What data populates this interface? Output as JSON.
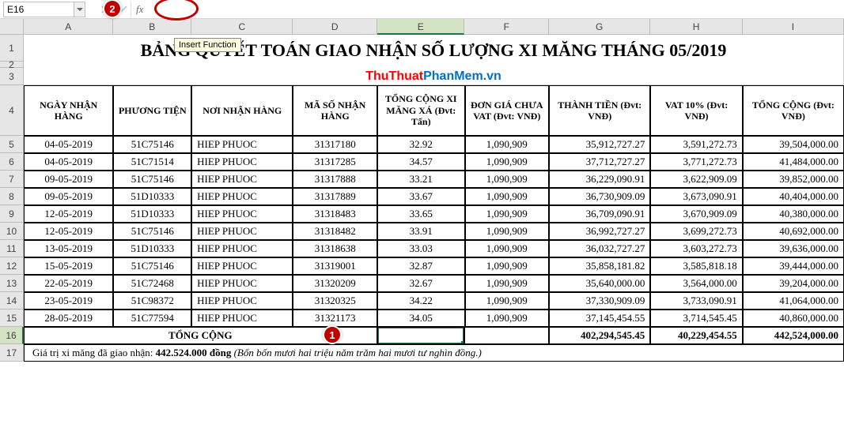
{
  "nameBox": "E16",
  "fxLabel": "fx",
  "tooltip": "Insert Function",
  "badge1": "1",
  "badge2": "2",
  "columns": [
    "A",
    "B",
    "C",
    "D",
    "E",
    "F",
    "G",
    "H",
    "I"
  ],
  "rows": [
    "1",
    "2",
    "3",
    "4",
    "5",
    "6",
    "7",
    "8",
    "9",
    "10",
    "11",
    "12",
    "13",
    "14",
    "15",
    "16",
    "17"
  ],
  "title": "BẢNG QUYẾT TOÁN GIAO NHẬN SỐ LƯỢNG XI MĂNG THÁNG 05/2019",
  "subtitleRed": "ThuThuat",
  "subtitleBlue": "PhanMem.vn",
  "headers": {
    "A": "NGÀY NHẬN HÀNG",
    "B": "PHƯƠNG TIỆN",
    "C": "NƠI NHẬN HÀNG",
    "D": "MÃ SỐ NHẬN HÀNG",
    "E": "TỔNG CỘNG XI MĂNG XÁ (Đvt: Tấn)",
    "F": "ĐƠN GIÁ CHƯA VAT (Đvt: VNĐ)",
    "G": "THÀNH TIỀN (Đvt: VNĐ)",
    "H": "VAT 10% (Đvt: VNĐ)",
    "I": "TỔNG CỘNG (Đvt: VNĐ)"
  },
  "data": [
    {
      "A": "04-05-2019",
      "B": "51C75146",
      "C": "HIEP PHUOC",
      "D": "31317180",
      "E": "32.92",
      "F": "1,090,909",
      "G": "35,912,727.27",
      "H": "3,591,272.73",
      "I": "39,504,000.00"
    },
    {
      "A": "04-05-2019",
      "B": "51C71514",
      "C": "HIEP PHUOC",
      "D": "31317285",
      "E": "34.57",
      "F": "1,090,909",
      "G": "37,712,727.27",
      "H": "3,771,272.73",
      "I": "41,484,000.00"
    },
    {
      "A": "09-05-2019",
      "B": "51C75146",
      "C": "HIEP PHUOC",
      "D": "31317888",
      "E": "33.21",
      "F": "1,090,909",
      "G": "36,229,090.91",
      "H": "3,622,909.09",
      "I": "39,852,000.00"
    },
    {
      "A": "09-05-2019",
      "B": "51D10333",
      "C": "HIEP PHUOC",
      "D": "31317889",
      "E": "33.67",
      "F": "1,090,909",
      "G": "36,730,909.09",
      "H": "3,673,090.91",
      "I": "40,404,000.00"
    },
    {
      "A": "12-05-2019",
      "B": "51D10333",
      "C": "HIEP PHUOC",
      "D": "31318483",
      "E": "33.65",
      "F": "1,090,909",
      "G": "36,709,090.91",
      "H": "3,670,909.09",
      "I": "40,380,000.00"
    },
    {
      "A": "12-05-2019",
      "B": "51C75146",
      "C": "HIEP PHUOC",
      "D": "31318482",
      "E": "33.91",
      "F": "1,090,909",
      "G": "36,992,727.27",
      "H": "3,699,272.73",
      "I": "40,692,000.00"
    },
    {
      "A": "13-05-2019",
      "B": "51D10333",
      "C": "HIEP PHUOC",
      "D": "31318638",
      "E": "33.03",
      "F": "1,090,909",
      "G": "36,032,727.27",
      "H": "3,603,272.73",
      "I": "39,636,000.00"
    },
    {
      "A": "15-05-2019",
      "B": "51C75146",
      "C": "HIEP PHUOC",
      "D": "31319001",
      "E": "32.87",
      "F": "1,090,909",
      "G": "35,858,181.82",
      "H": "3,585,818.18",
      "I": "39,444,000.00"
    },
    {
      "A": "22-05-2019",
      "B": "51C72468",
      "C": "HIEP PHUOC",
      "D": "31320209",
      "E": "32.67",
      "F": "1,090,909",
      "G": "35,640,000.00",
      "H": "3,564,000.00",
      "I": "39,204,000.00"
    },
    {
      "A": "23-05-2019",
      "B": "51C98372",
      "C": "HIEP PHUOC",
      "D": "31320325",
      "E": "34.22",
      "F": "1,090,909",
      "G": "37,330,909.09",
      "H": "3,733,090.91",
      "I": "41,064,000.00"
    },
    {
      "A": "28-05-2019",
      "B": "51C77594",
      "C": "HIEP PHUOC",
      "D": "31321173",
      "E": "34.05",
      "F": "1,090,909",
      "G": "37,145,454.55",
      "H": "3,714,545.45",
      "I": "40,860,000.00"
    }
  ],
  "totalLabel": "TỔNG CỘNG",
  "totals": {
    "G": "402,294,545.45",
    "H": "40,229,454.55",
    "I": "442,524,000.00"
  },
  "footerPrefix": "Giá trị xi măng đã giao nhận: ",
  "footerBold": "442.524.000 đồng",
  "footerItalic": " (Bốn bốn mươi hai triệu năm trăm hai mươi tư nghìn đồng.)"
}
